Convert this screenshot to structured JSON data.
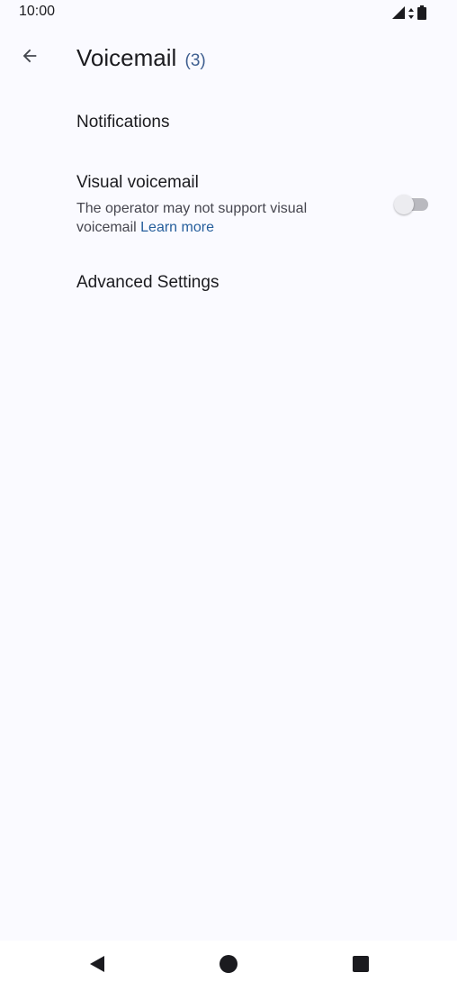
{
  "status_bar": {
    "time": "10:00",
    "icons": [
      "cell-signal-icon",
      "data-arrows-icon",
      "battery-icon"
    ]
  },
  "app_bar": {
    "back_icon": "arrow-back-icon",
    "title": "Voicemail",
    "count": "(3)"
  },
  "preferences": {
    "notifications": {
      "title": "Notifications"
    },
    "visual_voicemail": {
      "title": "Visual voicemail",
      "summary": "The operator may not support visual voicemail",
      "link": "Learn more",
      "toggle_on": false
    },
    "advanced": {
      "title": "Advanced Settings"
    }
  },
  "nav_bar": {
    "icons": [
      "back-triangle-icon",
      "home-circle-icon",
      "recents-square-icon"
    ]
  },
  "colors": {
    "background": "#fafaff",
    "accent": "#255e9c",
    "text": "#1b1b1f"
  }
}
